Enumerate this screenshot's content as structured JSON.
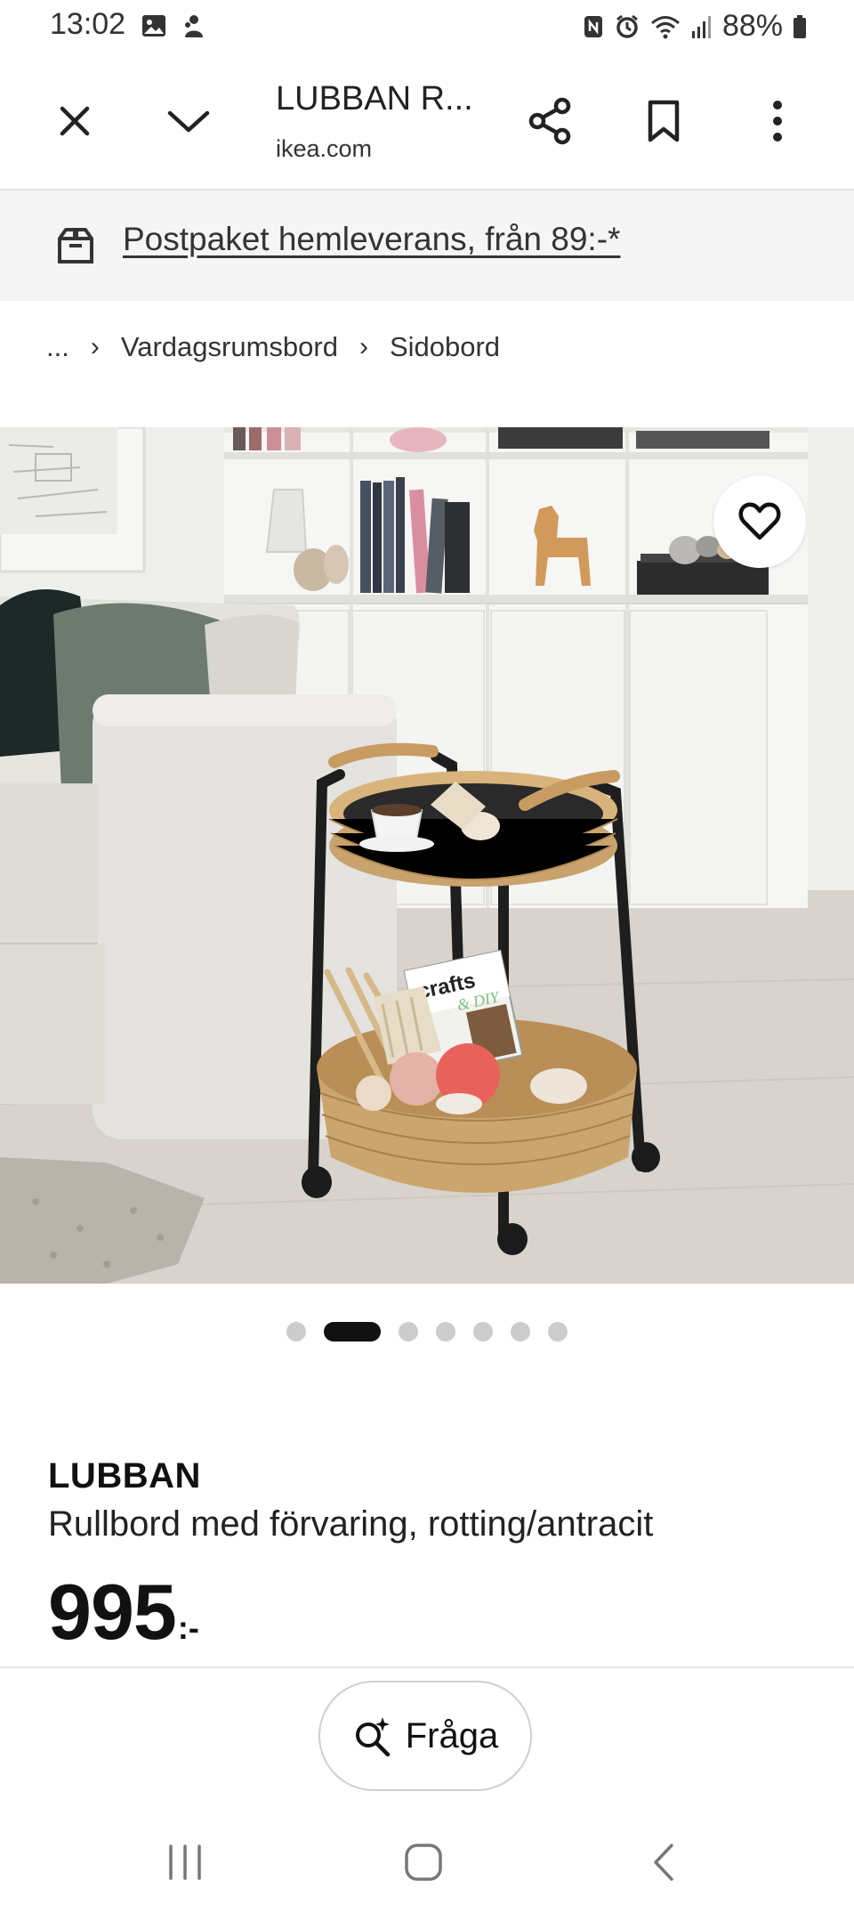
{
  "status_bar": {
    "time": "13:02",
    "battery": "88%",
    "icons_left": [
      "gallery-icon",
      "notification-icon"
    ],
    "icons_right": [
      "nfc-icon",
      "alarm-icon",
      "wifi-icon",
      "signal-icon",
      "battery-icon"
    ]
  },
  "toolbar": {
    "title": "LUBBAN R...",
    "url": "ikea.com",
    "icons": [
      "close-icon",
      "chevron-down-icon",
      "share-icon",
      "bookmark-icon",
      "more-icon"
    ]
  },
  "promo": {
    "text": "Postpaket hemleverans, från 89:-*",
    "icon": "delivery-box-icon"
  },
  "breadcrumb": {
    "ellipsis": "...",
    "items": [
      "Vardagsrumsbord",
      "Sidobord"
    ]
  },
  "image": {
    "magazine_text": "crafts",
    "magazine_subtext": "& DIY",
    "carousel_total": 7,
    "carousel_active_index": 1
  },
  "product": {
    "name": "LUBBAN",
    "description": "Rullbord med förvaring, rotting/antracit",
    "price": "995",
    "price_suffix": ":-"
  },
  "actions": {
    "ask_label": "Fråga"
  },
  "navbar": {
    "icons": [
      "recent-apps-icon",
      "home-icon",
      "back-icon"
    ]
  },
  "colors": {
    "accent": "#111111",
    "banner_bg": "#f5f5f5"
  }
}
